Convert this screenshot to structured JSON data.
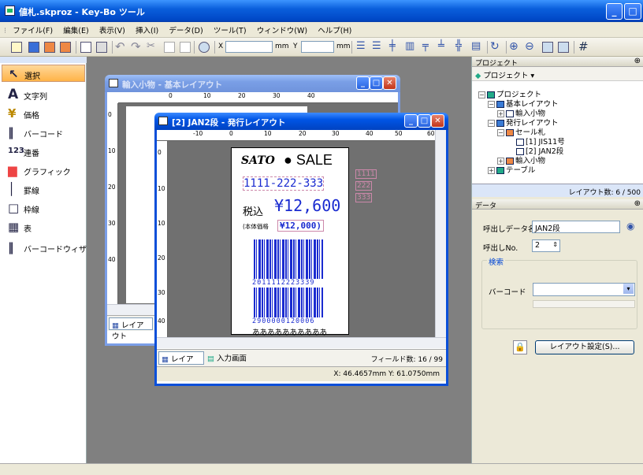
{
  "app": {
    "title": "値札.skproz - Key-Bo ツール"
  },
  "menu": [
    "ファイル(F)",
    "編集(E)",
    "表示(V)",
    "挿入(I)",
    "データ(D)",
    "ツール(T)",
    "ウィンドウ(W)",
    "ヘルプ(H)"
  ],
  "toolbar": {
    "x_label": "X",
    "y_label": "Y",
    "unit": "mm",
    "x_value": "",
    "y_value": ""
  },
  "tools": [
    {
      "label": "選択",
      "icon": "select-arrow-icon"
    },
    {
      "label": "文字列",
      "icon": "text-icon"
    },
    {
      "label": "価格",
      "icon": "price-icon"
    },
    {
      "label": "バーコード",
      "icon": "barcode-icon"
    },
    {
      "label": "連番",
      "icon": "sequence-icon"
    },
    {
      "label": "グラフィック",
      "icon": "graphic-icon"
    },
    {
      "label": "罫線",
      "icon": "line-icon"
    },
    {
      "label": "枠線",
      "icon": "frame-icon"
    },
    {
      "label": "表",
      "icon": "table-icon"
    },
    {
      "label": "バーコードウィザード",
      "icon": "barcode-wizard-icon"
    }
  ],
  "back_window": {
    "title": "輸入小物 - 基本レイアウト",
    "tab": "レイアウト",
    "ruler_h": [
      "0",
      "10",
      "20",
      "30",
      "40"
    ],
    "ruler_v": [
      "0",
      "10",
      "20",
      "30",
      "40"
    ]
  },
  "front_window": {
    "title": "[2] JAN2段 - 発行レイアウト",
    "ruler_h": [
      "-10",
      "0",
      "10",
      "20",
      "30",
      "40",
      "50",
      "60"
    ],
    "ruler_v": [
      "0",
      "10",
      "10",
      "20",
      "30",
      "40",
      "50"
    ],
    "tab_layout": "レイアウト",
    "tab_input": "入力画面",
    "field_count": "フィールド数: 16 / 99",
    "coords": "X: 46.4657mm Y: 61.0750mm"
  },
  "label": {
    "brand": "SATO",
    "sale": "● SALE",
    "phone": "1111-222-333",
    "tax_in": "税込",
    "price": "¥12,600",
    "base_price_label": "(本体価格",
    "base_price": "¥12,000)",
    "barcode1_digits": "2011112223339",
    "barcode2_digits": "2900000120006",
    "kana": "ああああああああああ",
    "side_codes": [
      "1111",
      "222",
      "333"
    ]
  },
  "project_panel": {
    "header": "プロジェクト",
    "dropdown": "プロジェクト ▾",
    "tree": [
      {
        "label": "プロジェクト",
        "level": 0
      },
      {
        "label": "基本レイアウト",
        "level": 1
      },
      {
        "label": "輸入小物",
        "level": 2
      },
      {
        "label": "発行レイアウト",
        "level": 1
      },
      {
        "label": "セール札",
        "level": 2
      },
      {
        "label": "[1] JIS11号",
        "level": 3
      },
      {
        "label": "[2] JAN2段",
        "level": 3
      },
      {
        "label": "輸入小物",
        "level": 2
      },
      {
        "label": "テーブル",
        "level": 1
      }
    ],
    "layout_count": "レイアウト数: 6 / 500"
  },
  "data_panel": {
    "header": "データ",
    "name_label": "呼出しデータ名",
    "name_value": "JAN2段",
    "no_label": "呼出しNo.",
    "no_value": "2",
    "search_group": "検索",
    "barcode_label": "バーコード",
    "barcode_value": "",
    "settings_button": "レイアウト設定(S)..."
  },
  "colors": {
    "accent": "#1a2bd0",
    "titlebar": "#0a5fdc",
    "workspace": "#808080"
  }
}
